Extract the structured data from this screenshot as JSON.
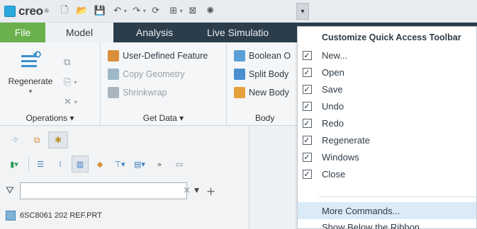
{
  "app": {
    "logo_text": "creo",
    "logo_reg": "®"
  },
  "qat": {
    "buttons": [
      {
        "icon": "new-file-icon",
        "glyph": "🗋"
      },
      {
        "icon": "open-folder-icon",
        "glyph": "📂"
      },
      {
        "icon": "save-icon",
        "glyph": "💾"
      },
      {
        "icon": "undo-icon",
        "glyph": "↶"
      },
      {
        "icon": "redo-icon",
        "glyph": "↷"
      },
      {
        "icon": "regenerate-icon",
        "glyph": "⟳"
      },
      {
        "icon": "windows-icon",
        "glyph": "⊞"
      },
      {
        "icon": "close-window-icon",
        "glyph": "⊠"
      },
      {
        "icon": "customize-icon",
        "glyph": "✺"
      }
    ],
    "customize_glyph": "▾"
  },
  "tabs": [
    {
      "label": "File"
    },
    {
      "label": "Model"
    },
    {
      "label": "Analysis"
    },
    {
      "label": "Live Simulatio"
    }
  ],
  "ribbon": {
    "operations": {
      "regenerate_label": "Regenerate",
      "group_label": "Operations ▾"
    },
    "getdata": {
      "items": [
        {
          "label": "User-Defined Feature",
          "disabled": false,
          "color": "#d98f3a"
        },
        {
          "label": "Copy Geometry",
          "disabled": true,
          "color": "#9fb8c9"
        },
        {
          "label": "Shrinkwrap",
          "disabled": true,
          "color": "#a9b6c0"
        }
      ],
      "group_label": "Get Data ▾"
    },
    "body": {
      "items": [
        {
          "label": "Boolean O",
          "color": "#5b9fd6"
        },
        {
          "label": "Split Body",
          "color": "#4a8fcf"
        },
        {
          "label": "New Body",
          "color": "#e6a23c"
        }
      ],
      "group_label": "Body"
    }
  },
  "panel": {
    "filter_placeholder": "",
    "filter_clear": "×",
    "filter_dropdown": "▼",
    "filter_add": "+",
    "filter_icon": "⛛",
    "tree_item": "6SC8061 202 REF.PRT"
  },
  "menu": {
    "title": "Customize Quick Access Toolbar",
    "items": [
      {
        "label": "New...",
        "checked": true
      },
      {
        "label": "Open",
        "checked": true
      },
      {
        "label": "Save",
        "checked": true
      },
      {
        "label": "Undo",
        "checked": true
      },
      {
        "label": "Redo",
        "checked": true
      },
      {
        "label": "Regenerate",
        "checked": true
      },
      {
        "label": "Windows",
        "checked": true
      },
      {
        "label": "Close",
        "checked": true
      }
    ],
    "more_commands": "More Commands...",
    "show_below": "Show Below the Ribbon",
    "check_glyph": "✓"
  }
}
